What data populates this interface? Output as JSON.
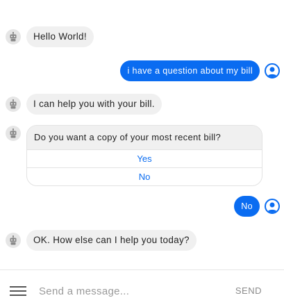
{
  "messages": [
    {
      "sender": "bot",
      "text": "Hello World!"
    },
    {
      "sender": "user",
      "text": "i have a question about my bill"
    },
    {
      "sender": "bot",
      "text": "I can help you with your bill."
    },
    {
      "sender": "bot",
      "type": "card",
      "text": "Do you want a copy of your most recent bill?",
      "options": [
        "Yes",
        "No"
      ]
    },
    {
      "sender": "user",
      "text": "No"
    },
    {
      "sender": "bot",
      "text": "OK. How else can I help you today?"
    }
  ],
  "composer": {
    "placeholder": "Send a message...",
    "send_label": "SEND"
  },
  "colors": {
    "accent": "#0a6cf1",
    "bot_bubble": "#f0f0f0"
  },
  "icons": {
    "bot": "robot-icon",
    "user": "user-icon",
    "menu": "hamburger-icon"
  }
}
